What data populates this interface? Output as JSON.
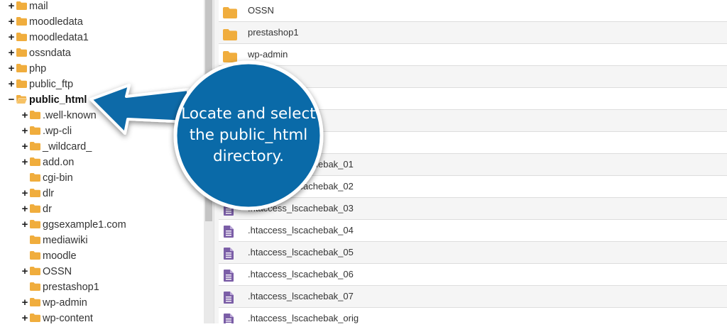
{
  "tree": {
    "items": [
      {
        "label": "mail",
        "toggle": "+",
        "level": 0,
        "state": "closed"
      },
      {
        "label": "moodledata",
        "toggle": "+",
        "level": 0,
        "state": "closed"
      },
      {
        "label": "moodledata1",
        "toggle": "+",
        "level": 0,
        "state": "closed"
      },
      {
        "label": "ossndata",
        "toggle": "+",
        "level": 0,
        "state": "closed"
      },
      {
        "label": "php",
        "toggle": "+",
        "level": 0,
        "state": "closed"
      },
      {
        "label": "public_ftp",
        "toggle": "+",
        "level": 0,
        "state": "closed"
      },
      {
        "label": "public_html",
        "toggle": "−",
        "level": 0,
        "state": "open",
        "selected": true
      },
      {
        "label": ".well-known",
        "toggle": "+",
        "level": 1,
        "state": "closed"
      },
      {
        "label": ".wp-cli",
        "toggle": "+",
        "level": 1,
        "state": "closed"
      },
      {
        "label": "_wildcard_",
        "toggle": "+",
        "level": 1,
        "state": "closed"
      },
      {
        "label": "add.on",
        "toggle": "+",
        "level": 1,
        "state": "closed"
      },
      {
        "label": "cgi-bin",
        "toggle": "",
        "level": 1,
        "state": "closed"
      },
      {
        "label": "dlr",
        "toggle": "+",
        "level": 1,
        "state": "closed"
      },
      {
        "label": "dr",
        "toggle": "+",
        "level": 1,
        "state": "closed"
      },
      {
        "label": "ggsexample1.com",
        "toggle": "+",
        "level": 1,
        "state": "closed"
      },
      {
        "label": "mediawiki",
        "toggle": "",
        "level": 1,
        "state": "closed"
      },
      {
        "label": "moodle",
        "toggle": "",
        "level": 1,
        "state": "closed"
      },
      {
        "label": "OSSN",
        "toggle": "+",
        "level": 1,
        "state": "closed"
      },
      {
        "label": "prestashop1",
        "toggle": "",
        "level": 1,
        "state": "closed"
      },
      {
        "label": "wp-admin",
        "toggle": "+",
        "level": 1,
        "state": "closed"
      },
      {
        "label": "wp-content",
        "toggle": "+",
        "level": 1,
        "state": "closed"
      }
    ]
  },
  "files": {
    "rows": [
      {
        "name": "OSSN",
        "icon": "folder-icon"
      },
      {
        "name": "prestashop1",
        "icon": "folder-icon"
      },
      {
        "name": "wp-admin",
        "icon": "folder-icon"
      },
      {
        "name": "",
        "icon": ""
      },
      {
        "name": "",
        "icon": ""
      },
      {
        "name": "",
        "icon": ""
      },
      {
        "name": "",
        "icon": ""
      },
      {
        "name": ".htaccess_lscachebak_01",
        "icon": "document-icon"
      },
      {
        "name": ".htaccess_lscachebak_02",
        "icon": "document-icon"
      },
      {
        "name": ".htaccess_lscachebak_03",
        "icon": "document-icon"
      },
      {
        "name": ".htaccess_lscachebak_04",
        "icon": "document-icon"
      },
      {
        "name": ".htaccess_lscachebak_05",
        "icon": "document-icon"
      },
      {
        "name": ".htaccess_lscachebak_06",
        "icon": "document-icon"
      },
      {
        "name": ".htaccess_lscachebak_07",
        "icon": "document-icon"
      },
      {
        "name": ".htaccess_lscachebak_orig",
        "icon": "document-icon"
      }
    ]
  },
  "callout": {
    "line1": "Locate and select",
    "line2": "the public_html",
    "line3": "directory."
  },
  "colors": {
    "folder": "#f0ad3d",
    "document": "#7b5ea7",
    "callout": "#0a6aa8",
    "callout_border": "#ffffff"
  }
}
